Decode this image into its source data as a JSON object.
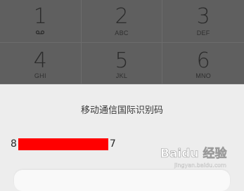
{
  "keypad": {
    "keys": [
      {
        "digit": "1",
        "letters": "",
        "icon": "voicemail-icon"
      },
      {
        "digit": "2",
        "letters": "ABC"
      },
      {
        "digit": "3",
        "letters": "DEF"
      },
      {
        "digit": "4",
        "letters": "GHI"
      },
      {
        "digit": "5",
        "letters": "JKL"
      },
      {
        "digit": "6",
        "letters": "MNO"
      }
    ]
  },
  "sheet": {
    "title": "移动通信国际识别码",
    "number_prefix": "8",
    "number_suffix": "7"
  },
  "watermark": {
    "text": "Baidu 经验",
    "url": "jingyan.baidu.com"
  },
  "colors": {
    "keypad_bg": "#5f5f5f",
    "sheet_bg": "#ededed",
    "redaction": "#ff0000"
  }
}
